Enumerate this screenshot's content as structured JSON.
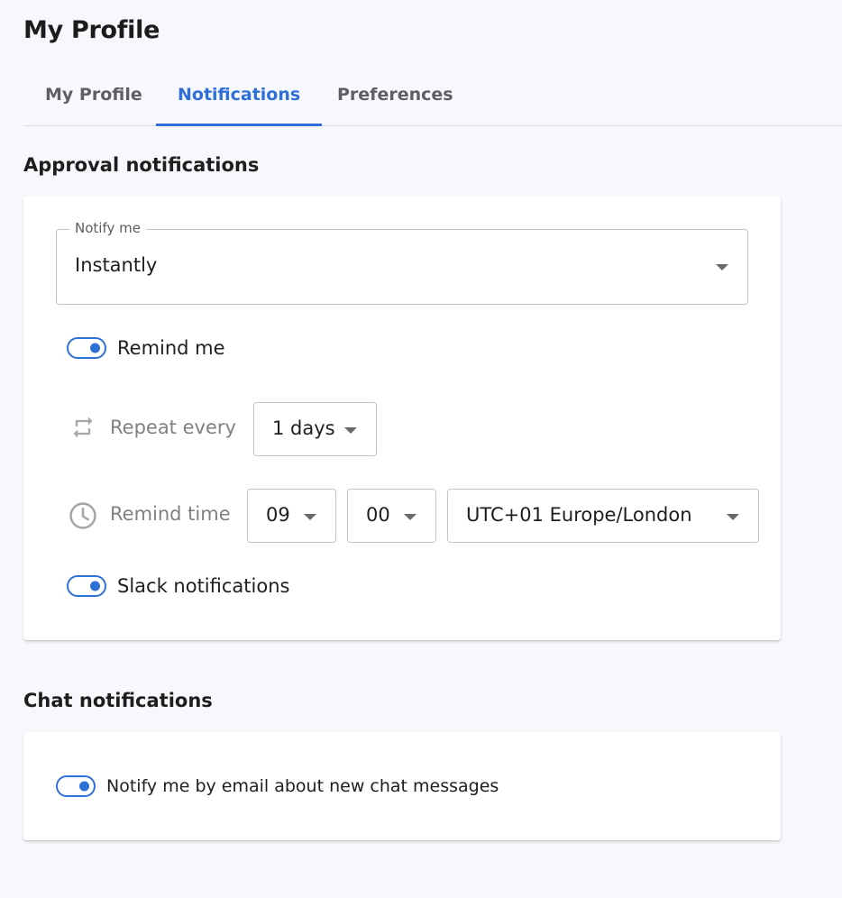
{
  "page": {
    "title": "My Profile"
  },
  "tabs": [
    {
      "label": "My Profile",
      "active": false
    },
    {
      "label": "Notifications",
      "active": true
    },
    {
      "label": "Preferences",
      "active": false
    }
  ],
  "approval": {
    "title": "Approval notifications",
    "notify_me": {
      "label": "Notify me",
      "value": "Instantly"
    },
    "remind_me": {
      "label": "Remind me",
      "on": true
    },
    "repeat": {
      "label": "Repeat every",
      "icon": "repeat-icon",
      "value": "1 days"
    },
    "remind_time": {
      "label": "Remind time",
      "icon": "clock-icon",
      "hour": "09",
      "minute": "00",
      "timezone": "UTC+01 Europe/London"
    },
    "slack": {
      "label": "Slack notifications",
      "on": true
    }
  },
  "chat": {
    "title": "Chat notifications",
    "email": {
      "label": "Notify me by email about new chat messages",
      "on": true
    }
  },
  "colors": {
    "accent": "#2f6fd8",
    "background": "#f7f8fc",
    "muted_text": "#808085"
  }
}
